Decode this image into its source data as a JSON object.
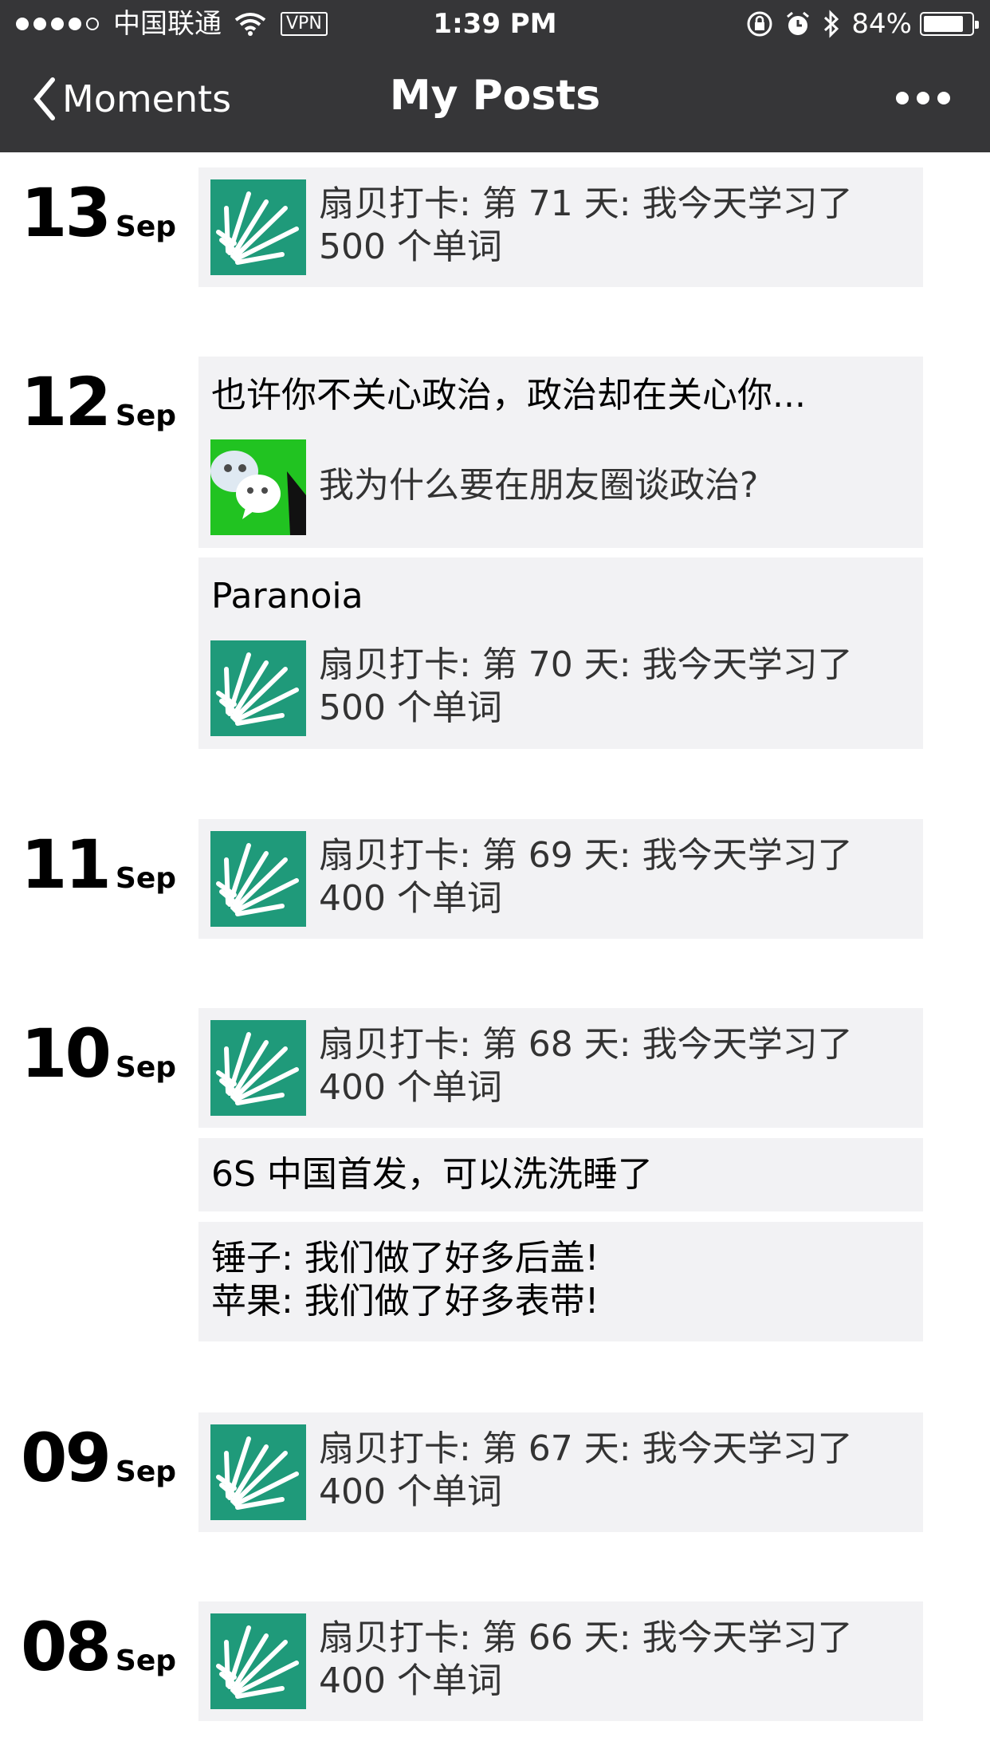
{
  "status_bar": {
    "carrier": "中国联通",
    "vpn": "VPN",
    "time": "1:39 PM",
    "battery": "84%",
    "battery_level": 0.84
  },
  "nav": {
    "back_label": "Moments",
    "title": "My Posts"
  },
  "colors": {
    "header_bg": "#363638",
    "card_bg": "#f2f2f4",
    "shanbay_green": "#1f9a7a",
    "wechat_green": "#21c321"
  },
  "days": [
    {
      "day": "13",
      "month": "Sep",
      "posts": [
        {
          "type": "link",
          "icon": "shanbay-icon",
          "text": "扇贝打卡: 第 71 天: 我今天学习了",
          "text2": "500 个单词"
        }
      ]
    },
    {
      "day": "12",
      "month": "Sep",
      "posts": [
        {
          "type": "share",
          "caption": "也许你不关心政治，政治却在关心你...",
          "icon": "wechat-icon",
          "text": "我为什么要在朋友圈谈政治?"
        },
        {
          "type": "share",
          "caption": "Paranoia",
          "icon": "shanbay-icon",
          "text": "扇贝打卡: 第 70 天: 我今天学习了",
          "text2": "500 个单词"
        }
      ]
    },
    {
      "day": "11",
      "month": "Sep",
      "posts": [
        {
          "type": "link",
          "icon": "shanbay-icon",
          "text": "扇贝打卡: 第 69 天: 我今天学习了",
          "text2": "400 个单词"
        }
      ]
    },
    {
      "day": "10",
      "month": "Sep",
      "posts": [
        {
          "type": "link",
          "icon": "shanbay-icon",
          "text": "扇贝打卡: 第 68 天: 我今天学习了",
          "text2": "400 个单词"
        },
        {
          "type": "text",
          "text": "6S 中国首发，可以洗洗睡了"
        },
        {
          "type": "text",
          "text": "锤子: 我们做了好多后盖!",
          "text2": "苹果: 我们做了好多表带!"
        }
      ]
    },
    {
      "day": "09",
      "month": "Sep",
      "posts": [
        {
          "type": "link",
          "icon": "shanbay-icon",
          "text": "扇贝打卡: 第 67 天: 我今天学习了",
          "text2": "400 个单词"
        }
      ]
    },
    {
      "day": "08",
      "month": "Sep",
      "posts": [
        {
          "type": "link",
          "icon": "shanbay-icon",
          "text": "扇贝打卡: 第 66 天: 我今天学习了",
          "text2": "400 个单词"
        }
      ]
    }
  ]
}
